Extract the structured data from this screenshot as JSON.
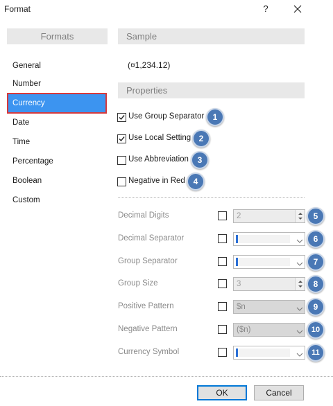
{
  "window": {
    "title": "Format",
    "help": "?"
  },
  "formats": {
    "header": "Formats",
    "items": [
      "General",
      "Number",
      "Currency",
      "Date",
      "Time",
      "Percentage",
      "Boolean",
      "Custom"
    ],
    "selected": "Currency"
  },
  "sample": {
    "header": "Sample",
    "value": "(¤1,234.12)"
  },
  "properties": {
    "header": "Properties",
    "checks": [
      {
        "label": "Use Group Separator",
        "checked": true,
        "badge": "1"
      },
      {
        "label": "Use Local Setting",
        "checked": true,
        "badge": "2"
      },
      {
        "label": "Use Abbreviation",
        "checked": false,
        "badge": "3"
      },
      {
        "label": "Negative in Red",
        "checked": false,
        "badge": "4"
      }
    ],
    "rows": [
      {
        "label": "Decimal Digits",
        "kind": "spin",
        "value": "2",
        "badge": "5"
      },
      {
        "label": "Decimal Separator",
        "kind": "combo",
        "value": "",
        "badge": "6"
      },
      {
        "label": "Group Separator",
        "kind": "combo",
        "value": "",
        "badge": "7"
      },
      {
        "label": "Group Size",
        "kind": "spin",
        "value": "3",
        "badge": "8"
      },
      {
        "label": "Positive Pattern",
        "kind": "combo-disabled",
        "value": "$n",
        "badge": "9"
      },
      {
        "label": "Negative Pattern",
        "kind": "combo-disabled",
        "value": "($n)",
        "badge": "10"
      },
      {
        "label": "Currency Symbol",
        "kind": "combo",
        "value": "",
        "badge": "11"
      }
    ]
  },
  "buttons": {
    "ok": "OK",
    "cancel": "Cancel"
  },
  "colors": {
    "selection": "#3c94f0",
    "selection_outline": "#d6393c",
    "badge": "#4a78b5"
  }
}
